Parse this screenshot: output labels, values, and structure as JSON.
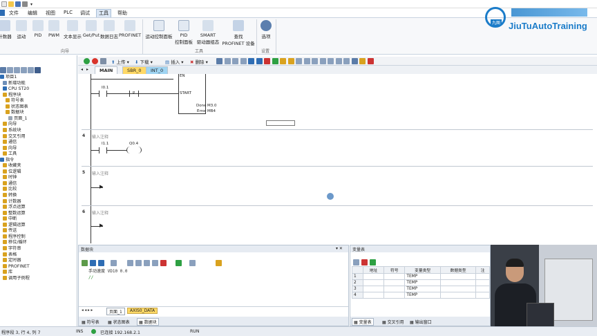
{
  "menubar": {
    "items": [
      "文件",
      "编辑",
      "视图",
      "PLC",
      "调试",
      "工具",
      "帮助"
    ],
    "active": "工具"
  },
  "ribbon": {
    "wizard_items": [
      "计数器",
      "运动",
      "PID",
      "PWM",
      "文本显示",
      "Get/Put",
      "数据日志",
      "PROFINET"
    ],
    "wizard_group": "向导",
    "tool_items": [
      "运动控制面板",
      "PID\n控制面板",
      "SMART\n驱动器组态",
      "查找\nPROFINET 设备"
    ],
    "tool_group": "工具",
    "settings_item": "选项",
    "settings_group": "设置"
  },
  "brand": {
    "name": "JiuTuAutoTraining",
    "badge": "九图"
  },
  "tree": {
    "items": [
      "项目1",
      "新增功能",
      "CPU ST20",
      "程序块",
      "符号表",
      "状态图表",
      "数据块",
      "页面_1",
      "向导",
      "系统块",
      "交叉引用",
      "通信",
      "向导",
      "工具",
      "指令",
      "收藏夹",
      "位逻辑",
      "时钟",
      "通信",
      "比较",
      "转换",
      "计数器",
      "浮点运算",
      "整数运算",
      "中断",
      "逻辑运算",
      "传送",
      "程序控制",
      "移位/循环",
      "字符串",
      "表格",
      "定时器",
      "PROFINET",
      "库",
      "调用子例程"
    ]
  },
  "editor_toolbar": {
    "upload": "上传",
    "download": "下载",
    "insert": "插入",
    "delete": "删除"
  },
  "tabs": [
    {
      "label": "MAIN",
      "color": "#ffffff"
    },
    {
      "label": "SBR_0",
      "color": "#ffd966"
    },
    {
      "label": "INT_0",
      "color": "#9fd4f2"
    }
  ],
  "editor": {
    "networks": [
      {
        "num": "",
        "comment": "",
        "contacts": [
          "I0.1",
          "P"
        ],
        "box_inputs": [
          "EN",
          "START"
        ],
        "box_outputs": [
          "Done",
          "Error"
        ],
        "out_addrs": [
          "M3.0",
          "MB4"
        ]
      },
      {
        "num": "4",
        "comment": "输入注释",
        "contacts": [
          "I1.1"
        ],
        "coil": "Q0.4"
      },
      {
        "num": "5",
        "comment": "输入注释"
      },
      {
        "num": "6",
        "comment": "输入注释"
      }
    ]
  },
  "data_panel": {
    "title": "数据块",
    "line1": "手动速度 VD10 0.0",
    "line2": "//",
    "tabs": [
      "页面_1",
      "AXIS0_DATA"
    ],
    "bottom_tabs": [
      "符号表",
      "状态图表",
      "数据块"
    ]
  },
  "var_panel": {
    "title": "变量表",
    "headers": [
      "",
      "地址",
      "符号",
      "变量类型",
      "数据类型",
      "注"
    ],
    "rows": [
      {
        "n": "1",
        "type": "TEMP"
      },
      {
        "n": "2",
        "type": "TEMP"
      },
      {
        "n": "3",
        "type": "TEMP"
      },
      {
        "n": "4",
        "type": "TEMP"
      }
    ],
    "bottom_tabs": [
      "变量表",
      "交叉引用",
      "输出窗口"
    ]
  },
  "status": {
    "position": "程序段 3, 行 4, 列 7",
    "mode": "INS",
    "connection": "已连接 192.168.2.1",
    "run": "RUN"
  },
  "colors": {
    "ribbon_bg": "#f7f8fa",
    "accent": "#2e6db4",
    "brand": "#1b7cc9"
  }
}
